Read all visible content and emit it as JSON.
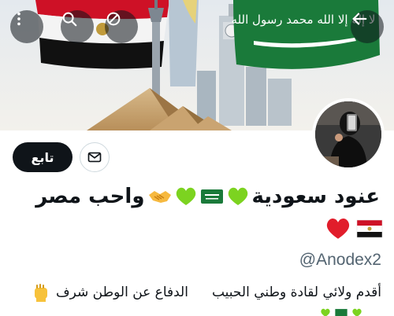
{
  "profile": {
    "display_name": "عنود سعودية",
    "display_name_tail": "واحب مصر",
    "handle": "@Anodex2",
    "bio_part1": "أقدم ولائي لقادة وطني الحبيب",
    "bio_part2": "الدفاع عن الوطن شرف"
  },
  "actions": {
    "follow_label": "تابع"
  },
  "banner": {
    "saudi_flag_text": "لا إله إلا الله محمد رسول الله"
  },
  "icons": {
    "back": "arrow-left-icon",
    "menu": "more-vertical-icon",
    "search": "search-icon",
    "block": "no-symbol-icon",
    "mail": "mail-icon"
  },
  "colors": {
    "follow_bg": "#0f1419",
    "saudi_green": "#1a7a3a",
    "egypt_red": "#ce1126",
    "handle_gray": "#536471"
  }
}
